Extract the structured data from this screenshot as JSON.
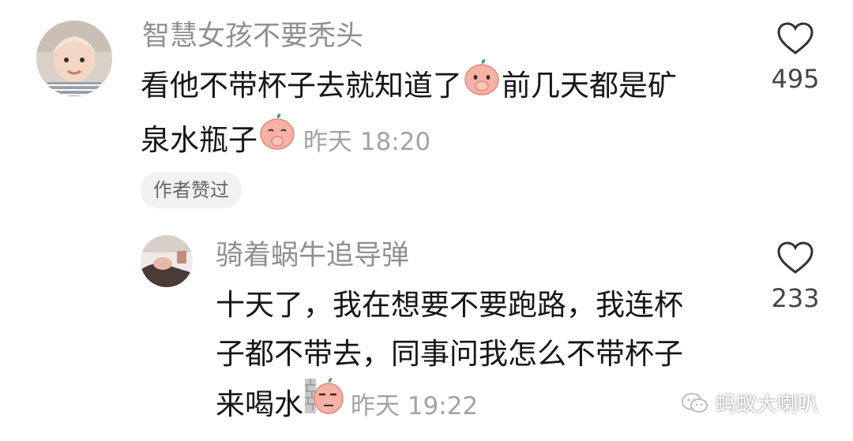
{
  "comments": [
    {
      "username": "智慧女孩不要秃头",
      "text_line1": "看他不带杯子去就知道了",
      "text_line1_after_emoji": "前几天都是矿",
      "text_line2": "泉水瓶子",
      "time": "昨天 18:20",
      "likes": "495",
      "badge": "作者赞过",
      "emoji_1": "peach-cover-mouth-emoji",
      "emoji_2": "peach-shy-emoji"
    },
    {
      "username": "骑着蜗牛追导弹",
      "text_line1": "十天了，我在想要不要跑路，我连杯",
      "text_line2": "子都不带去，同事问我怎么不带杯子",
      "text_line3": "来喝水",
      "time": "昨天 19:22",
      "likes": "233",
      "emoji": "peach-wall-peek-emoji"
    }
  ],
  "watermark": "蚂蚁大喇叭",
  "colors": {
    "username": "#8f8f93",
    "text": "#161616",
    "time": "#a3a3a6",
    "badge_bg": "#f2f2f3",
    "peach": "#f7b1a6"
  }
}
